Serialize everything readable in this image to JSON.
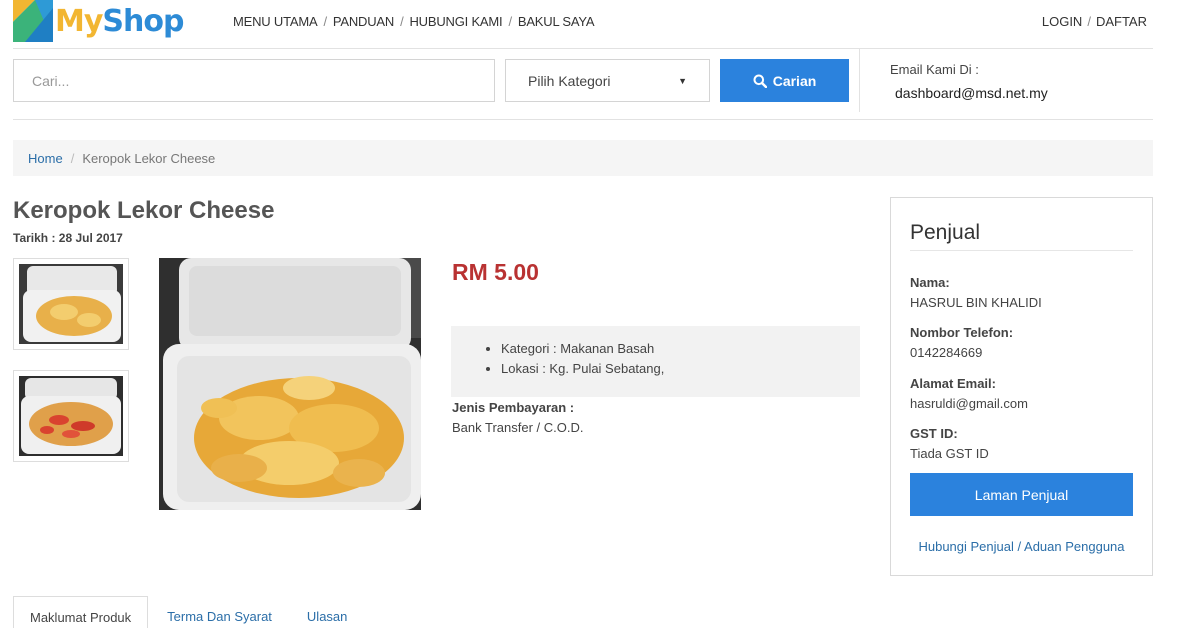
{
  "brand": {
    "logo_my": "My",
    "logo_shop": "Shop"
  },
  "nav": {
    "items": [
      "MENU UTAMA",
      "PANDUAN",
      "HUBUNGI KAMI",
      "BAKUL SAYA"
    ],
    "login": "LOGIN",
    "register": "DAFTAR"
  },
  "search": {
    "placeholder": "Cari...",
    "category_selected": "Pilih Kategori",
    "button_label": "Carian"
  },
  "contact": {
    "label": "Email Kami Di :",
    "email": "dashboard@msd.net.my"
  },
  "breadcrumb": {
    "home": "Home",
    "current": "Keropok Lekor Cheese"
  },
  "product": {
    "title": "Keropok Lekor Cheese",
    "date": "Tarikh : 28 Jul 2017",
    "price": "RM 5.00",
    "category": "Kategori : Makanan Basah",
    "location": "Lokasi : Kg. Pulai Sebatang,",
    "payment_label": "Jenis Pembayaran :",
    "payment_value": "Bank Transfer / C.O.D."
  },
  "seller": {
    "title": "Penjual",
    "name_label": "Nama:",
    "name": "HASRUL BIN KHALIDI",
    "phone_label": "Nombor Telefon:",
    "phone": "0142284669",
    "email_label": "Alamat Email:",
    "email": "hasruldi@gmail.com",
    "gst_label": "GST ID:",
    "gst": "Tiada GST ID",
    "page_button": "Laman Penjual",
    "contact_link": "Hubungi Penjual",
    "separator": "/",
    "report_link": "Aduan Pengguna"
  },
  "tabs": [
    "Maklumat Produk",
    "Terma Dan Syarat",
    "Ulasan"
  ],
  "colors": {
    "accent": "#2b82dd",
    "price": "#b93232",
    "link": "#2b6ea8"
  },
  "icons": {
    "search_button": "search-icon",
    "select": "caret-down-icon"
  }
}
